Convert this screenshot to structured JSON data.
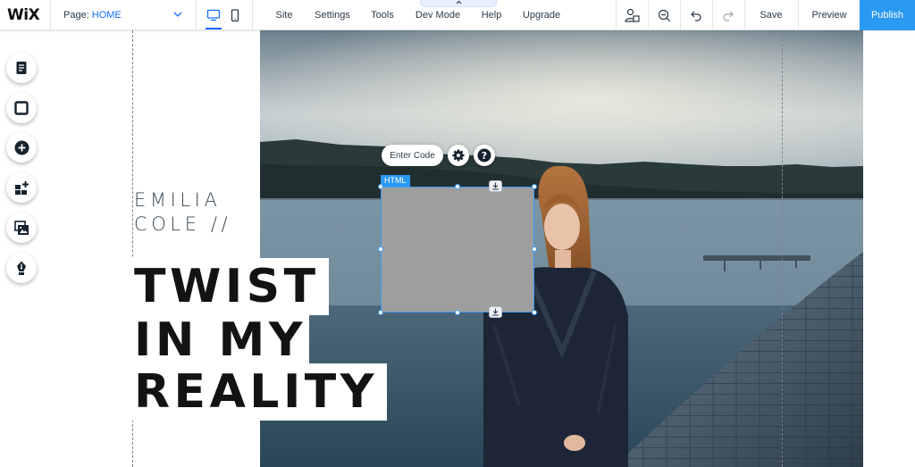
{
  "app": {
    "logo": "WiX"
  },
  "page_selector": {
    "label": "Page:",
    "value": "HOME"
  },
  "menu": [
    "Site",
    "Settings",
    "Tools",
    "Dev Mode",
    "Help",
    "Upgrade"
  ],
  "actions": {
    "save": "Save",
    "preview": "Preview",
    "publish": "Publish"
  },
  "widget": {
    "enter_code": "Enter Code",
    "tag": "HTML"
  },
  "hero": {
    "subtitle_line1": "EMILIA",
    "subtitle_line2": "COLE //",
    "title_line1": "TWIST",
    "title_line2": "IN MY",
    "title_line3": "REALITY"
  },
  "rail_icons": [
    "pages-icon",
    "background-icon",
    "add-icon",
    "app-market-icon",
    "media-icon",
    "blog-pen-icon"
  ],
  "colors": {
    "accent": "#116dff",
    "publish_bg": "#2a99f2",
    "selection": "#3d9bf3"
  }
}
